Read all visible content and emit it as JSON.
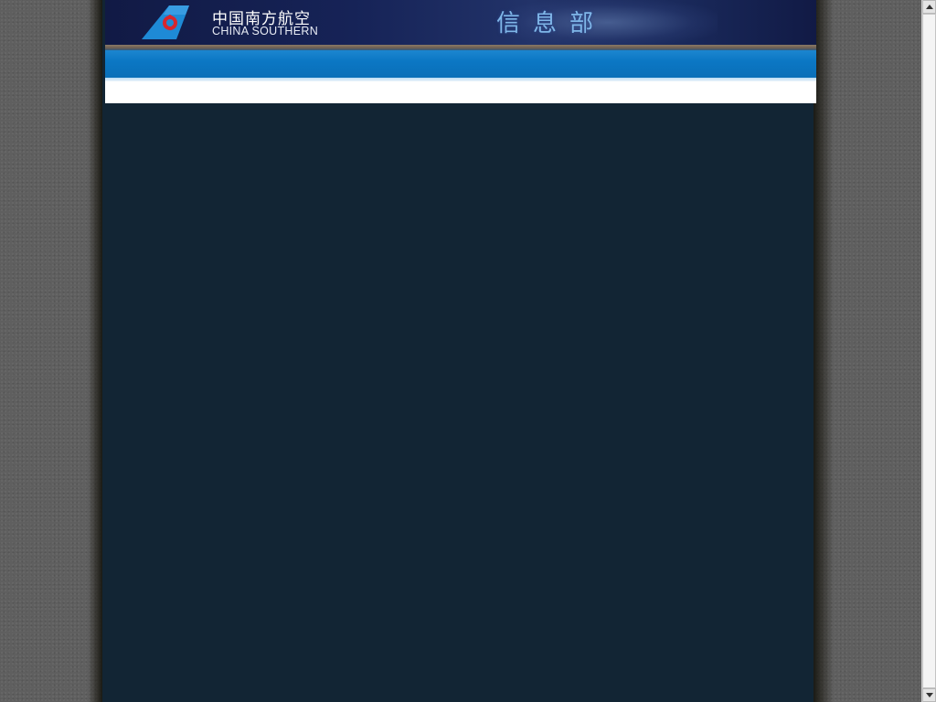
{
  "header": {
    "brand_cn": "中国南方航空",
    "brand_en": "CHINA SOUTHERN",
    "department_title": "信息部",
    "logo_icon": "kapok-tail-logo-icon"
  },
  "colors": {
    "header_bg": "#162357",
    "nav_bar": "#0b77c4",
    "content_bg": "#122534",
    "title_text": "#7fb6e8"
  },
  "icons": {
    "scroll_up": "triangle-up",
    "scroll_down": "triangle-down"
  }
}
